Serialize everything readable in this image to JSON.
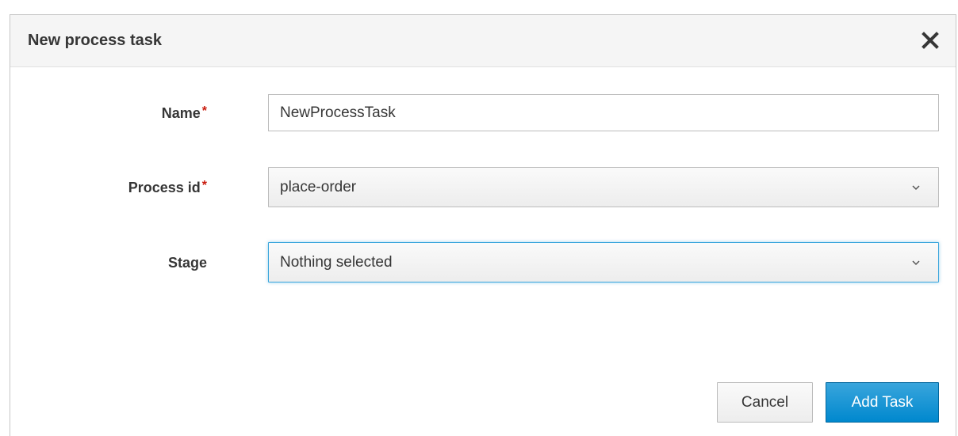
{
  "dialog": {
    "title": "New process task",
    "close_icon": "close-icon"
  },
  "form": {
    "name": {
      "label": "Name",
      "required_mark": "*",
      "value": "NewProcessTask"
    },
    "process_id": {
      "label": "Process id",
      "required_mark": "*",
      "selected": "place-order"
    },
    "stage": {
      "label": "Stage",
      "selected": "Nothing selected"
    }
  },
  "footer": {
    "cancel_label": "Cancel",
    "add_label": "Add Task"
  },
  "colors": {
    "primary": "#0088ce",
    "required": "#c9190b",
    "focus": "#39a5dc"
  }
}
